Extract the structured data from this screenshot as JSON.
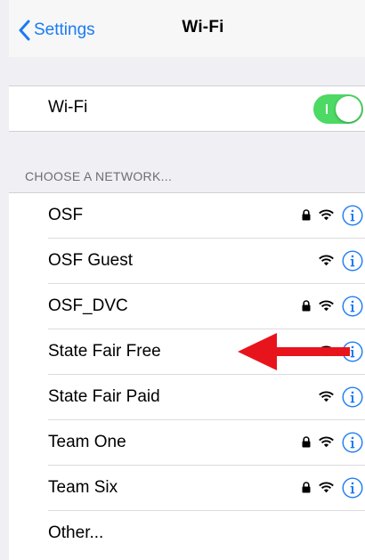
{
  "navbar": {
    "back_label": "Settings",
    "title": "Wi-Fi"
  },
  "wifi_toggle": {
    "label": "Wi-Fi",
    "state": "on"
  },
  "section": {
    "header": "CHOOSE A NETWORK..."
  },
  "networks": [
    {
      "name": "OSF",
      "secured": true
    },
    {
      "name": "OSF Guest",
      "secured": false
    },
    {
      "name": "OSF_DVC",
      "secured": true
    },
    {
      "name": "State Fair Free",
      "secured": false
    },
    {
      "name": "State Fair Paid",
      "secured": false
    },
    {
      "name": "Team One",
      "secured": true
    },
    {
      "name": "Team Six",
      "secured": true
    }
  ],
  "other_label": "Other...",
  "colors": {
    "accent": "#1a7bf2",
    "toggle_on": "#4cd964",
    "annotation": "#e8141c",
    "background": "#efeff4"
  },
  "icons": {
    "back": "chevron-left-icon",
    "lock": "lock-icon",
    "wifi": "wifi-signal-icon",
    "info": "info-icon",
    "annotation": "red-arrow-icon"
  }
}
